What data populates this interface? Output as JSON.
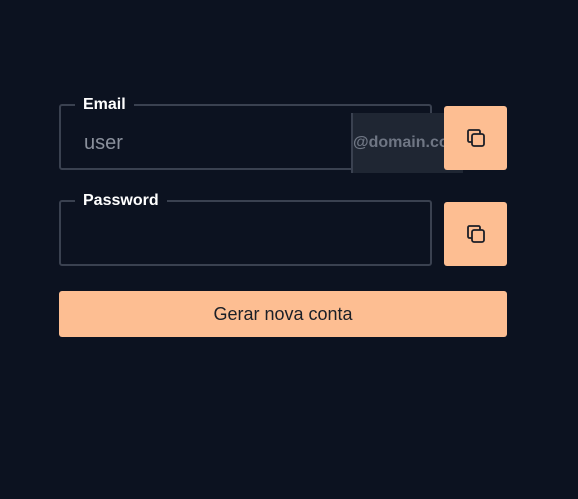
{
  "email": {
    "label": "Email",
    "placeholder": "user",
    "domain": "@domain.com",
    "copy_icon": "copy-icon"
  },
  "password": {
    "label": "Password",
    "value": "",
    "copy_icon": "copy-icon"
  },
  "generate_button": {
    "label": "Gerar nova conta"
  },
  "colors": {
    "background": "#0c1220",
    "accent": "#fdbe92",
    "border": "#3a4150",
    "addon_background": "#1f2633"
  }
}
